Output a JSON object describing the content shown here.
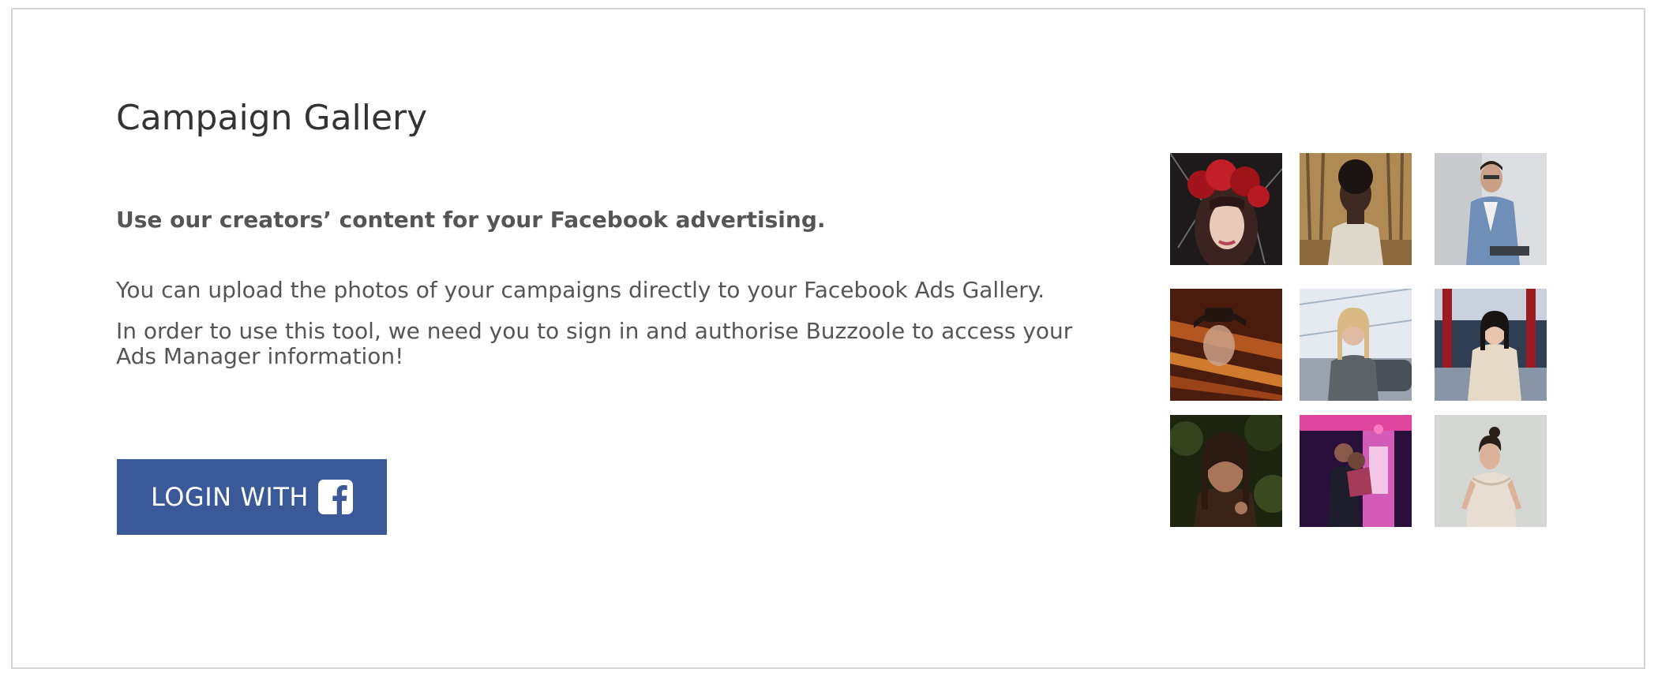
{
  "page": {
    "title": "Campaign Gallery",
    "lead": "Use our creators’ content for your Facebook advertising.",
    "paragraph_1": "You can upload the photos of your campaigns directly to your Facebook Ads Gallery.",
    "paragraph_2": "In order to use this tool, we need you to sign in and authorise Buzzoole to access your Ads Manager information!"
  },
  "login_button": {
    "label": "LOGIN WITH",
    "icon": "facebook-icon",
    "background": "#3b5998",
    "text_color": "#ffffff"
  },
  "gallery": {
    "photos": [
      {
        "subject": "woman with red flower crown"
      },
      {
        "subject": "man in white hoodie in forest"
      },
      {
        "subject": "man in denim jacket"
      },
      {
        "subject": "man in hat with warm lighting"
      },
      {
        "subject": "blonde woman by car"
      },
      {
        "subject": "woman in coat in hallway"
      },
      {
        "subject": "woman in dark foliage"
      },
      {
        "subject": "couple in neon purple light"
      },
      {
        "subject": "woman in light dress"
      }
    ]
  }
}
